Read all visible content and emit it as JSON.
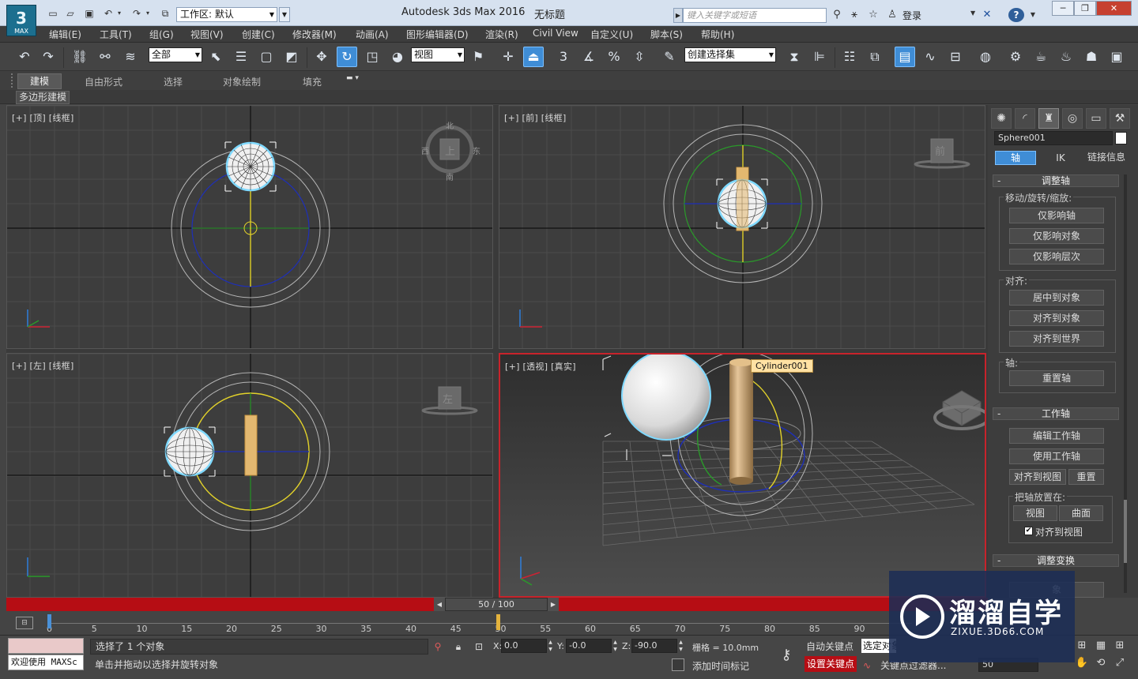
{
  "logo": {
    "symbol": "3",
    "label": "MAX"
  },
  "title": {
    "app": "Autodesk 3ds Max 2016",
    "document": "无标题",
    "workspace": "工作区: 默认",
    "search_placeholder": "键入关键字或短语",
    "login": "登录"
  },
  "menus": [
    "编辑(E)",
    "工具(T)",
    "组(G)",
    "视图(V)",
    "创建(C)",
    "修改器(M)",
    "动画(A)",
    "图形编辑器(D)",
    "渲染(R)",
    "Civil View",
    "自定义(U)",
    "脚本(S)",
    "帮助(H)"
  ],
  "toolbar": {
    "filter_value": "全部",
    "coord_value": "视图",
    "selset_value": "创建选择集",
    "icons": [
      "undo-icon",
      "redo-icon",
      "link-icon",
      "unlink-icon",
      "bind-spacewarp-icon",
      "select-object-icon",
      "select-by-name-icon",
      "rect-region-icon",
      "window-crossing-icon",
      "move-icon",
      "rotate-icon",
      "scale-icon",
      "place-icon",
      "snap-toggle-icon",
      "angle-snap-icon",
      "percent-snap-icon",
      "spinner-snap-icon",
      "mirror-icon",
      "align-icon",
      "layer-icon",
      "ribbon-toggle-icon",
      "curve-editor-icon",
      "schematic-icon",
      "material-editor-icon",
      "render-setup-icon",
      "rendered-frame-icon",
      "render-icon",
      "render-iterative-icon"
    ],
    "snap_label": "3",
    "percent_label": "%"
  },
  "ribbon": {
    "tabs": [
      "建模",
      "自由形式",
      "选择",
      "对象绘制",
      "填充"
    ],
    "sub_tab": "多边形建模"
  },
  "viewports": {
    "top": {
      "label": "[+] [顶] [线框]",
      "cube": {
        "n": "北",
        "w": "西",
        "e": "东",
        "s": "南",
        "face": "上"
      }
    },
    "front": {
      "label": "[+] [前] [线框]",
      "cube_face": "前"
    },
    "left": {
      "label": "[+] [左] [线框]",
      "cube_face": "左"
    },
    "persp": {
      "label": "[+] [透视] [真实]",
      "tooltip": "Cylinder001"
    }
  },
  "command_panel": {
    "object_name": "Sphere001",
    "object_color": "#ffffff",
    "hier_tabs": [
      "轴",
      "IK",
      "链接信息"
    ],
    "roll_adjust_pivot": "调整轴",
    "group_move": "移动/旋转/缩放:",
    "btn_affect_pivot": "仅影响轴",
    "btn_affect_object": "仅影响对象",
    "btn_affect_hier": "仅影响层次",
    "group_align": "对齐:",
    "btn_center": "居中到对象",
    "btn_align_obj": "对齐到对象",
    "btn_align_world": "对齐到世界",
    "group_pivot": "轴:",
    "btn_reset_pivot": "重置轴",
    "roll_working_pivot": "工作轴",
    "btn_edit_wp": "编辑工作轴",
    "btn_use_wp": "使用工作轴",
    "btn_align_view": "对齐到视图",
    "btn_reset": "重置",
    "group_place": "把轴放置在:",
    "btn_view": "视图",
    "btn_surface": "曲面",
    "chk_align_view": "对齐到视图",
    "roll_adjust_transform": "调整变换",
    "partial_btn": "象",
    "tab_icons": [
      "create-icon",
      "modify-icon",
      "hierarchy-icon",
      "motion-icon",
      "display-icon",
      "utilities-icon"
    ]
  },
  "timeline": {
    "frame": "50 / 100",
    "ticks": [
      "0",
      "5",
      "10",
      "15",
      "20",
      "25",
      "30",
      "35",
      "40",
      "45",
      "50",
      "55",
      "60",
      "65",
      "70",
      "75",
      "80",
      "85",
      "90"
    ],
    "current_frame_fraction": 0.5
  },
  "status": {
    "maxscript": "欢迎使用 MAXSc",
    "selection": "选择了 1 个对象",
    "prompt": "单击并拖动以选择并旋转对象",
    "x": "0.0",
    "y": "-0.0",
    "z": "-90.0",
    "x_label": "X:",
    "y_label": "Y:",
    "z_label": "Z:",
    "grid": "栅格 = 10.0mm",
    "add_time_tag": "添加时间标记",
    "auto_key": "自动关键点",
    "set_key": "设置关键点",
    "selected_set": "选定对象",
    "key_filter": "关键点过滤器...",
    "frame_field": "50"
  },
  "watermark": {
    "text": "溜溜自学",
    "sub": "ZIXUE.3D66.COM"
  },
  "colors": {
    "accent": "#3f8dd6",
    "active_vp_border": "#c8232b",
    "timeline_red": "#b60d14",
    "sphere_select": "#7fd9ff"
  }
}
